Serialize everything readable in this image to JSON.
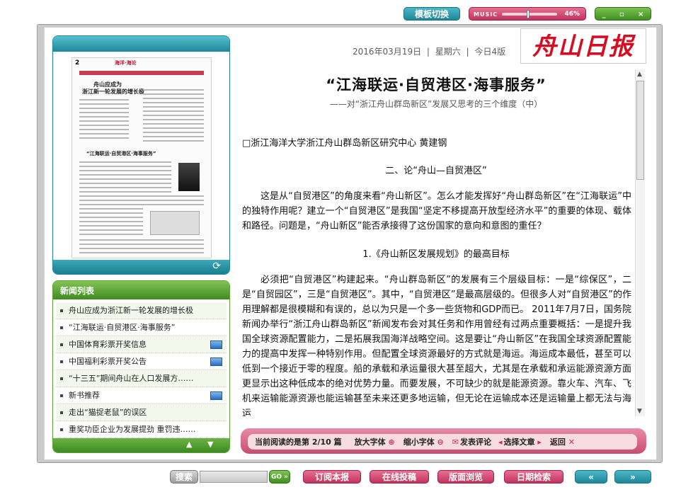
{
  "top": {
    "template_switch": "模板切换",
    "music_label": "MUSIC",
    "music_volume": "46%",
    "window_controls": [
      "_",
      "▫",
      "×"
    ]
  },
  "date_bar": {
    "date": "2016年03月19日",
    "weekday": "星期六",
    "edition": "今日4版"
  },
  "logo": "舟山日报",
  "thumbnail": {
    "page_num": "2",
    "header": "海洋·海论",
    "headline1": "舟山应成为",
    "headline2": "浙江新一轮发展的增长极",
    "headline3": "“江海联运·自贸港区·海事服务”"
  },
  "news_list": {
    "title": "新闻列表",
    "items": [
      {
        "label": "舟山应成为浙江新一轮发展的增长极",
        "flag": false
      },
      {
        "label": "“江海联运·自贸港区·海事服务”",
        "flag": false
      },
      {
        "label": "中国体育彩票开奖信息",
        "flag": true
      },
      {
        "label": "中国福利彩票开奖公告",
        "flag": true
      },
      {
        "label": "“十三五”期间舟山在人口发展方……",
        "flag": false
      },
      {
        "label": "新书推荐",
        "flag": true
      },
      {
        "label": "走出“猫捉老鼠”的误区",
        "flag": false
      },
      {
        "label": "重奖功臣企业为发展提劲 重罚违……",
        "flag": false
      }
    ]
  },
  "article": {
    "title": "“江海联运·自贸港区·海事服务”",
    "subtitle": "——对“浙江舟山群岛新区”发展又思考的三个维度（中）",
    "author": "□浙江海洋大学浙江舟山群岛新区研究中心 黄建钢",
    "section": "二、论“舟山—自贸港区”",
    "p1": "这是从“自贸港区”的角度来看“舟山新区”。怎么才能发挥好“舟山群岛新区”在“江海联运”中的独特作用呢？建立一个“自贸港区”是我国“坚定不移提高开放型经济水平”的重要的体现、载体和路径。问题是，“舟山新区”能否承接得了这份国家的意向和意图的重任？",
    "sub1": "1.《舟山新区发展规划》的最高目标",
    "p2": "必须把“自贸港区”构建起来。“舟山群岛新区”的发展有三个层级目标：一是“综保区”，二是“自贸园区”，三是“自贸港区”。其中，“自贸港区”是最高层级的。但很多人对“自贸港区”的作用理解都是很模糊和有误的，总以为只是一个多一些货物和GDP而已。 2011年7月7日，国务院新闻办举行“浙江舟山群岛新区”新闻发布会对其任务和作用曾经有过两点重要概括：一是提升我国全球资源配置能力，二是拓展我国海洋战略空间。这是要让“舟山新区”在我国全球资源配置能力的提高中发挥一种特别作用。但配置全球资源最好的方式就是海运。海运成本最低，甚至可以低到一个接近于零的程度。船的承载和承运量很大甚至超大，尤其是在承载和承运能源资源方面更显示出这种低成本的绝对优势力量。而要发展，不可缺少的就是能源资源。靠火车、汽车、飞机来运输能源资源也能运输甚至未来还更多地运输，但无论在运输成本还是运输量上都无法与海运"
  },
  "reader": {
    "reading": "当前阅读的是第 2/10 篇",
    "enlarge": "放大字体",
    "shrink": "缩小字体",
    "comment": "发表评论",
    "select": "选择文章",
    "back": "返回"
  },
  "bottom": {
    "search_label": "搜索",
    "go": "GO »",
    "subscribe": "订阅本报",
    "submit": "在线投稿",
    "browse": "版面浏览",
    "date_search": "日期检索",
    "prev": "«",
    "next": "»"
  },
  "colors": {
    "brand_red": "#d40f24",
    "teal": "#1f8798",
    "pink": "#c2335e",
    "green": "#3f8f22"
  }
}
